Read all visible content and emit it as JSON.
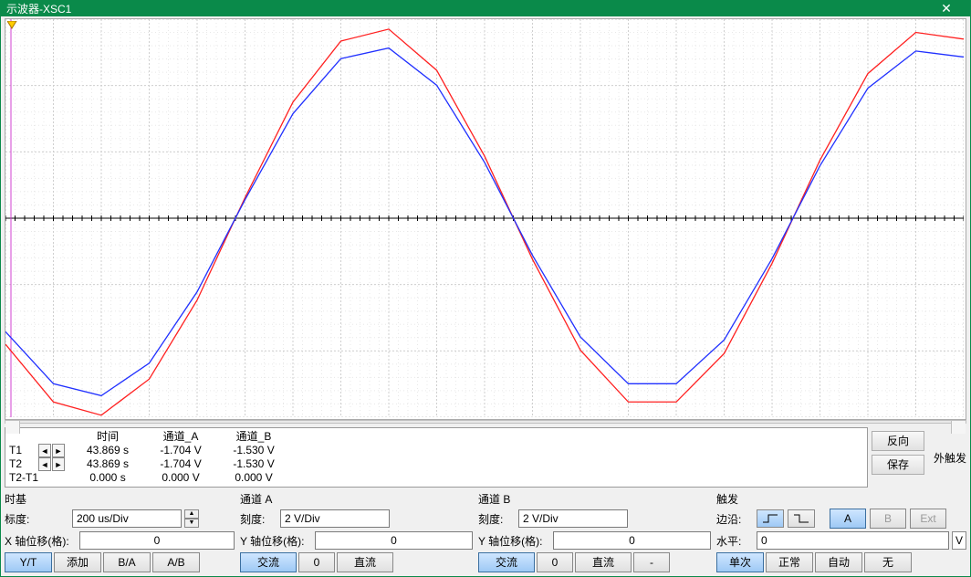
{
  "window": {
    "title": "示波器-XSC1"
  },
  "chart_data": {
    "type": "line",
    "x_units": "divisions",
    "x_range": [
      0,
      20
    ],
    "y_range_div": [
      -3,
      3
    ],
    "grid": true,
    "series": [
      {
        "name": "通道_A",
        "color": "#ff2020",
        "scale_V_per_div": 2,
        "x": [
          0,
          1,
          2,
          3,
          4,
          5,
          6,
          7,
          8,
          9,
          10,
          11,
          12,
          13,
          14,
          15,
          16,
          17,
          18,
          19,
          20
        ],
        "y_V": [
          -3.8,
          -5.54,
          -5.94,
          -4.85,
          -2.47,
          0.62,
          3.5,
          5.34,
          5.7,
          4.46,
          1.87,
          -1.24,
          -3.98,
          -5.54,
          -5.54,
          -4.08,
          -1.36,
          1.75,
          4.36,
          5.6,
          5.4
        ]
      },
      {
        "name": "通道_B",
        "color": "#2030ff",
        "scale_V_per_div": 2,
        "x": [
          0,
          1,
          2,
          3,
          4,
          5,
          6,
          7,
          8,
          9,
          10,
          11,
          12,
          13,
          14,
          15,
          16,
          17,
          18,
          19,
          20
        ],
        "y_V": [
          -3.42,
          -4.99,
          -5.35,
          -4.37,
          -2.22,
          0.56,
          3.15,
          4.81,
          5.13,
          4.01,
          1.68,
          -1.12,
          -3.58,
          -4.99,
          -4.99,
          -3.67,
          -1.22,
          1.58,
          3.92,
          5.04,
          4.86
        ]
      }
    ]
  },
  "readout": {
    "headers": {
      "time": "时间",
      "chA": "通道_A",
      "chB": "通道_B"
    },
    "rows": {
      "T1": {
        "label": "T1",
        "time": "43.869 s",
        "chA": "-1.704 V",
        "chB": "-1.530 V"
      },
      "T2": {
        "label": "T2",
        "time": "43.869 s",
        "chA": "-1.704 V",
        "chB": "-1.530 V"
      },
      "diff": {
        "label": "T2-T1",
        "time": "0.000 s",
        "chA": "0.000 V",
        "chB": "0.000 V"
      }
    },
    "buttons": {
      "reverse": "反向",
      "save": "保存",
      "ext_trigger": "外触发"
    }
  },
  "timebase": {
    "title": "时基",
    "scale_label": "标度:",
    "scale_value": "200 us/Div",
    "xpos_label": "X 轴位移(格):",
    "xpos_value": "0",
    "buttons": {
      "yt": "Y/T",
      "add": "添加",
      "ba": "B/A",
      "ab": "A/B"
    }
  },
  "channelA": {
    "title": "通道 A",
    "scale_label": "刻度:",
    "scale_value": "2  V/Div",
    "ypos_label": "Y 轴位移(格):",
    "ypos_value": "0",
    "buttons": {
      "ac": "交流",
      "zero": "0",
      "dc": "直流"
    }
  },
  "channelB": {
    "title": "通道 B",
    "scale_label": "刻度:",
    "scale_value": "2  V/Div",
    "ypos_label": "Y 轴位移(格):",
    "ypos_value": "0",
    "buttons": {
      "ac": "交流",
      "zero": "0",
      "dc": "直流",
      "minus": "-"
    }
  },
  "trigger": {
    "title": "触发",
    "edge_label": "边沿:",
    "level_label": "水平:",
    "level_value": "0",
    "level_unit": "V",
    "source": {
      "A": "A",
      "B": "B",
      "Ext": "Ext"
    },
    "mode": {
      "single": "单次",
      "normal": "正常",
      "auto": "自动",
      "none": "无"
    }
  }
}
